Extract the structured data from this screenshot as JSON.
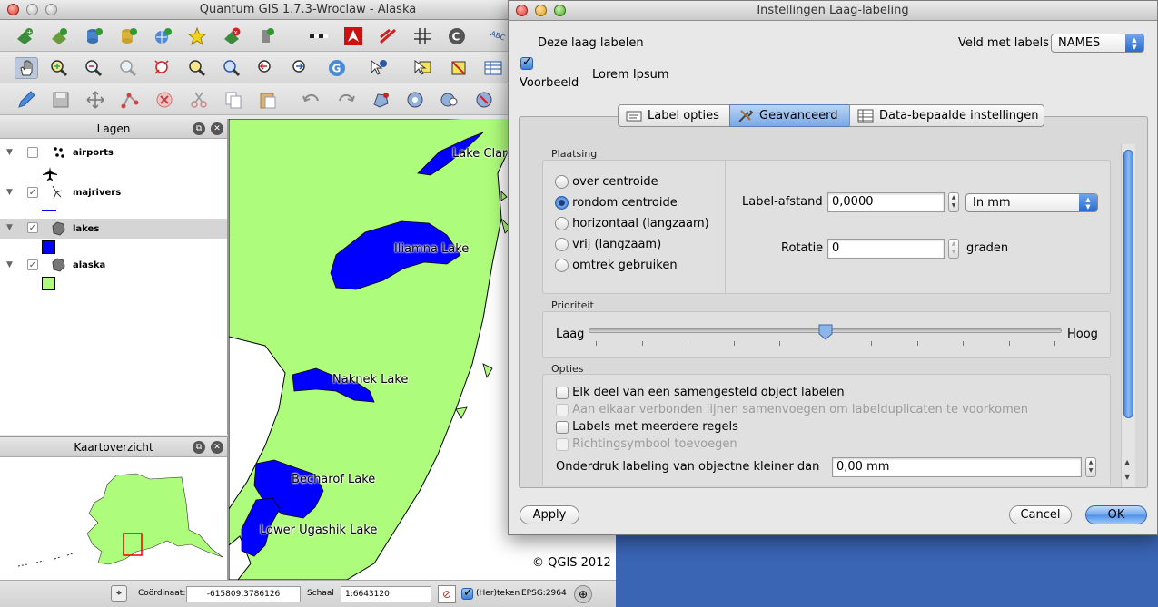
{
  "main_window": {
    "title": "Quantum GIS 1.7.3-Wroclaw - Alaska"
  },
  "layers_panel": {
    "title": "Lagen",
    "layers": [
      {
        "name": "airports",
        "checked": false
      },
      {
        "name": "majrivers",
        "checked": true
      },
      {
        "name": "lakes",
        "checked": true,
        "selected": true
      },
      {
        "name": "alaska",
        "checked": true
      }
    ]
  },
  "overview_panel": {
    "title": "Kaartoverzicht"
  },
  "map": {
    "labels": [
      "Lake Clark",
      "Iliamna Lake",
      "Naknek Lake",
      "Becharof Lake",
      "Lower Ugashik Lake"
    ],
    "copyright": "© QGIS 2012",
    "colors": {
      "land": "#aefc7b",
      "lakes": "#0000ff",
      "sea": "#ffffff"
    }
  },
  "status_bar": {
    "coord_label": "Coördinaat:",
    "coord_value": "-615809,3786126",
    "scale_label": "Schaal",
    "scale_value": "1:6643120",
    "render_label": "(Her)teken",
    "epsg": "EPSG:2964"
  },
  "dialog": {
    "title": "Instellingen Laag-labeling",
    "label_this_layer": "Deze laag labelen",
    "field_label": "Veld met labels",
    "field_value": "NAMES",
    "preview_label": "Voorbeeld",
    "preview_text": "Lorem Ipsum",
    "tabs": [
      "Label opties",
      "Geavanceerd",
      "Data-bepaalde instellingen"
    ],
    "active_tab": "Geavanceerd",
    "placement": {
      "title": "Plaatsing",
      "options": [
        "over centroide",
        "rondom centroide",
        "horizontaal (langzaam)",
        "vrij (langzaam)",
        "omtrek gebruiken"
      ],
      "selected": "rondom centroide",
      "distance_label": "Label-afstand",
      "distance_value": "0,0000",
      "unit_value": "In mm",
      "rotation_label": "Rotatie",
      "rotation_value": "0",
      "rotation_unit": "graden"
    },
    "priority": {
      "title": "Prioriteit",
      "low": "Laag",
      "high": "Hoog",
      "level": 0.5
    },
    "options": {
      "title": "Opties",
      "items": [
        {
          "label": "Elk deel van een samengesteld object labelen",
          "checked": false,
          "enabled": true
        },
        {
          "label": "Aan elkaar verbonden lijnen samenvoegen om labelduplicaten te voorkomen",
          "checked": false,
          "enabled": false
        },
        {
          "label": "Labels met meerdere regels",
          "checked": false,
          "enabled": true
        },
        {
          "label": "Richtingsymbool toevoegen",
          "checked": false,
          "enabled": false
        }
      ],
      "suppress_label": "Onderdruk labeling van objectne kleiner dan",
      "suppress_value": "0,00 mm"
    },
    "buttons": {
      "apply": "Apply",
      "cancel": "Cancel",
      "ok": "OK"
    }
  }
}
